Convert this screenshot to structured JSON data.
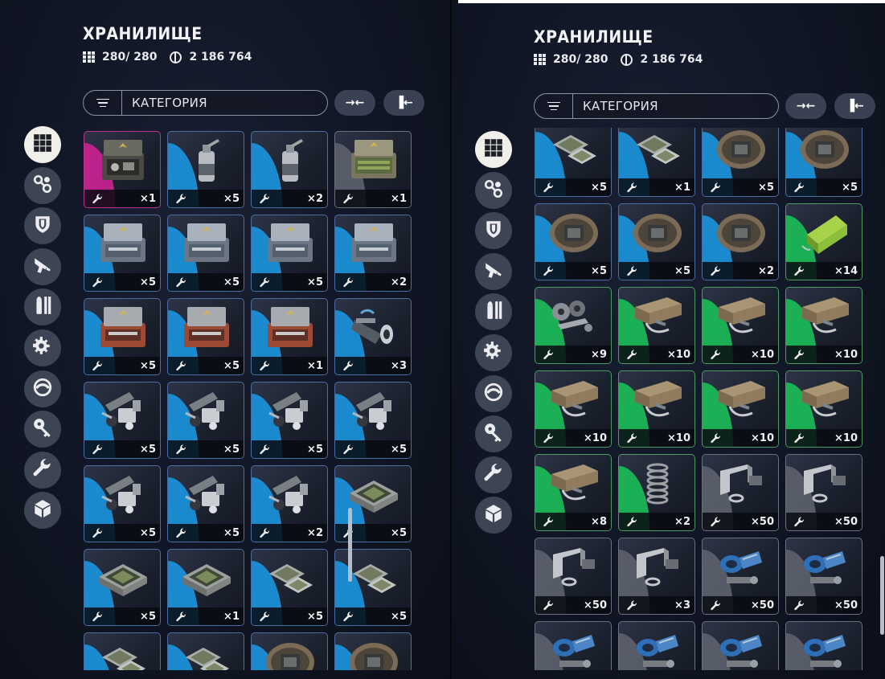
{
  "title": "ХРАНИЛИЩЕ",
  "capacity": "280/ 280",
  "currency": "2 186 764",
  "filter_label": "КАТЕГОРИЯ",
  "buttons": {
    "collapse": "→←",
    "align": "▐←"
  },
  "categories": [
    {
      "icon": "grid-icon",
      "active": true
    },
    {
      "icon": "parts-icon",
      "active": false
    },
    {
      "icon": "armor-icon",
      "active": false
    },
    {
      "icon": "weapon-icon",
      "active": false
    },
    {
      "icon": "ammo-icon",
      "active": false
    },
    {
      "icon": "gear-weapon-icon",
      "active": false
    },
    {
      "icon": "scope-icon",
      "active": false
    },
    {
      "icon": "key-icon",
      "active": false
    },
    {
      "icon": "wrench-icon",
      "active": false
    },
    {
      "icon": "box-icon",
      "active": false
    }
  ],
  "left_items": [
    {
      "rarity": "purple",
      "art": "case",
      "qty": "×1"
    },
    {
      "rarity": "blue",
      "art": "bottle",
      "qty": "×5"
    },
    {
      "rarity": "blue",
      "art": "bottle",
      "qty": "×2"
    },
    {
      "rarity": "gray",
      "art": "case-tan",
      "qty": "×1"
    },
    {
      "rarity": "blue",
      "art": "case-gray",
      "qty": "×5"
    },
    {
      "rarity": "blue",
      "art": "case-gray",
      "qty": "×5"
    },
    {
      "rarity": "blue",
      "art": "case-gray",
      "qty": "×5"
    },
    {
      "rarity": "blue",
      "art": "case-gray",
      "qty": "×2"
    },
    {
      "rarity": "blue",
      "art": "case-red",
      "qty": "×5"
    },
    {
      "rarity": "blue",
      "art": "case-red",
      "qty": "×5"
    },
    {
      "rarity": "blue",
      "art": "case-red",
      "qty": "×1"
    },
    {
      "rarity": "blue",
      "art": "cylinder",
      "qty": "×3"
    },
    {
      "rarity": "blue",
      "art": "parts",
      "qty": "×5"
    },
    {
      "rarity": "blue",
      "art": "parts",
      "qty": "×5"
    },
    {
      "rarity": "blue",
      "art": "parts",
      "qty": "×5"
    },
    {
      "rarity": "blue",
      "art": "parts",
      "qty": "×5"
    },
    {
      "rarity": "blue",
      "art": "parts",
      "qty": "×5"
    },
    {
      "rarity": "blue",
      "art": "parts",
      "qty": "×5"
    },
    {
      "rarity": "blue",
      "art": "parts",
      "qty": "×2"
    },
    {
      "rarity": "blue",
      "art": "tray",
      "qty": "×5"
    },
    {
      "rarity": "blue",
      "art": "tray",
      "qty": "×5"
    },
    {
      "rarity": "blue",
      "art": "tray",
      "qty": "×1"
    },
    {
      "rarity": "blue",
      "art": "chip",
      "qty": "×5"
    },
    {
      "rarity": "blue",
      "art": "chip",
      "qty": "×5"
    },
    {
      "rarity": "blue",
      "art": "chip",
      "qty": ""
    },
    {
      "rarity": "blue",
      "art": "chip",
      "qty": ""
    },
    {
      "rarity": "blue",
      "art": "disc",
      "qty": ""
    },
    {
      "rarity": "blue",
      "art": "disc",
      "qty": ""
    }
  ],
  "right_items": [
    {
      "rarity": "blue",
      "art": "chip",
      "qty": "×5"
    },
    {
      "rarity": "blue",
      "art": "chip",
      "qty": "×1"
    },
    {
      "rarity": "blue",
      "art": "disc",
      "qty": "×5"
    },
    {
      "rarity": "blue",
      "art": "disc",
      "qty": "×5"
    },
    {
      "rarity": "blue",
      "art": "disc",
      "qty": "×5"
    },
    {
      "rarity": "blue",
      "art": "disc",
      "qty": "×5"
    },
    {
      "rarity": "blue",
      "art": "disc",
      "qty": "×2"
    },
    {
      "rarity": "green",
      "art": "battery",
      "qty": "×14"
    },
    {
      "rarity": "green",
      "art": "gears",
      "qty": "×9"
    },
    {
      "rarity": "green",
      "art": "crate",
      "qty": "×10"
    },
    {
      "rarity": "green",
      "art": "crate",
      "qty": "×10"
    },
    {
      "rarity": "green",
      "art": "crate",
      "qty": "×10"
    },
    {
      "rarity": "green",
      "art": "crate",
      "qty": "×10"
    },
    {
      "rarity": "green",
      "art": "crate",
      "qty": "×10"
    },
    {
      "rarity": "green",
      "art": "crate",
      "qty": "×10"
    },
    {
      "rarity": "green",
      "art": "crate",
      "qty": "×10"
    },
    {
      "rarity": "green",
      "art": "crate",
      "qty": "×8"
    },
    {
      "rarity": "green",
      "art": "spring",
      "qty": "×2"
    },
    {
      "rarity": "gray",
      "art": "bracket",
      "qty": "×50"
    },
    {
      "rarity": "gray",
      "art": "bracket",
      "qty": "×50"
    },
    {
      "rarity": "gray",
      "art": "bracket",
      "qty": "×50"
    },
    {
      "rarity": "gray",
      "art": "bracket",
      "qty": "×3"
    },
    {
      "rarity": "gray",
      "art": "blue-mech",
      "qty": "×50"
    },
    {
      "rarity": "gray",
      "art": "blue-mech",
      "qty": "×50"
    },
    {
      "rarity": "gray",
      "art": "blue-mech",
      "qty": ""
    },
    {
      "rarity": "gray",
      "art": "blue-mech",
      "qty": ""
    },
    {
      "rarity": "gray",
      "art": "blue-mech",
      "qty": ""
    },
    {
      "rarity": "gray",
      "art": "blue-mech",
      "qty": ""
    }
  ]
}
